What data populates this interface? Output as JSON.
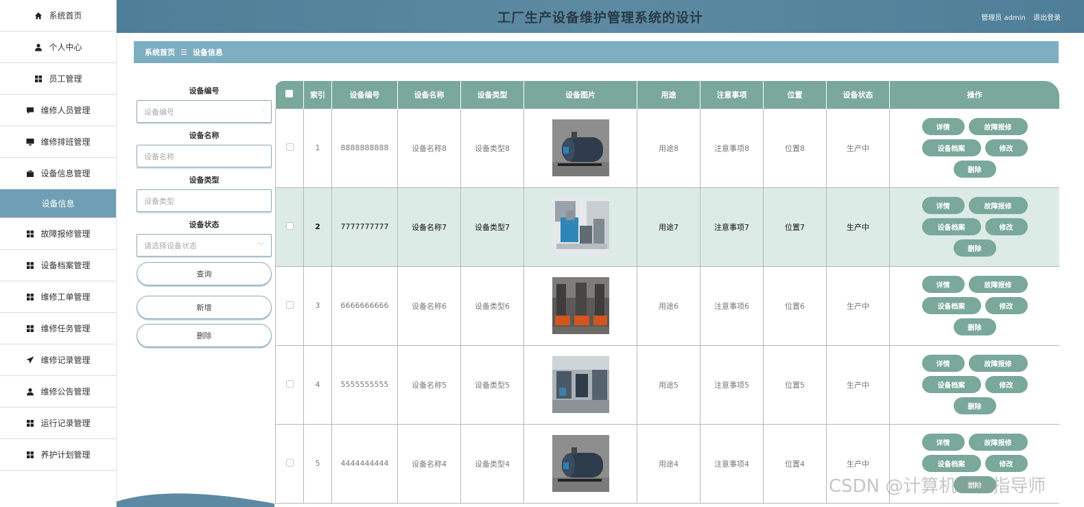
{
  "header": {
    "title": "工厂生产设备维护管理系统的设计",
    "user_label": "管理员 admin",
    "logout": "退出登录"
  },
  "sidebar": {
    "items": [
      {
        "label": "系统首页",
        "icon": "home-icon"
      },
      {
        "label": "个人中心",
        "icon": "user-icon"
      },
      {
        "label": "员工管理",
        "icon": "grid-icon"
      },
      {
        "label": "维修人员管理",
        "icon": "chat-icon"
      },
      {
        "label": "维修排班管理",
        "icon": "monitor-icon"
      },
      {
        "label": "设备信息管理",
        "icon": "wallet-icon"
      },
      {
        "label": "设备信息",
        "icon": ""
      },
      {
        "label": "故障报修管理",
        "icon": "grid-icon"
      },
      {
        "label": "设备档案管理",
        "icon": "grid-icon"
      },
      {
        "label": "维修工单管理",
        "icon": "grid-icon"
      },
      {
        "label": "维修任务管理",
        "icon": "grid-icon"
      },
      {
        "label": "维修记录管理",
        "icon": "send-icon"
      },
      {
        "label": "维修公告管理",
        "icon": "user-icon"
      },
      {
        "label": "运行记录管理",
        "icon": "grid-icon"
      },
      {
        "label": "养护计划管理",
        "icon": "grid-icon"
      }
    ]
  },
  "breadcrumb": {
    "home": "系统首页",
    "separator": "☰",
    "current": "设备信息"
  },
  "search": {
    "code_label": "设备编号",
    "code_placeholder": "设备编号",
    "name_label": "设备名称",
    "name_placeholder": "设备名称",
    "type_label": "设备类型",
    "type_placeholder": "设备类型",
    "status_label": "设备状态",
    "status_placeholder": "请选择设备状态",
    "query_btn": "查询",
    "add_btn": "新增",
    "delete_btn": "删除"
  },
  "table": {
    "headers": [
      "索引",
      "设备编号",
      "设备名称",
      "设备类型",
      "设备图片",
      "用途",
      "注意事项",
      "位置",
      "设备状态",
      "操作"
    ],
    "rows": [
      {
        "index": "1",
        "code": "8888888888",
        "name": "设备名称8",
        "type": "设备类型8",
        "image": "boiler",
        "use": "用途8",
        "note": "注意事项8",
        "location": "位置8",
        "status": "生产中"
      },
      {
        "index": "2",
        "code": "7777777777",
        "name": "设备名称7",
        "type": "设备类型7",
        "image": "blue-machine",
        "use": "用途7",
        "note": "注意事项7",
        "location": "位置7",
        "status": "生产中"
      },
      {
        "index": "3",
        "code": "6666666666",
        "name": "设备名称6",
        "type": "设备类型6",
        "image": "orange-line",
        "use": "用途6",
        "note": "注意事项6",
        "location": "位置6",
        "status": "生产中"
      },
      {
        "index": "4",
        "code": "5555555555",
        "name": "设备名称5",
        "type": "设备类型5",
        "image": "workshop",
        "use": "用途5",
        "note": "注意事项5",
        "location": "位置5",
        "status": "生产中"
      },
      {
        "index": "5",
        "code": "4444444444",
        "name": "设备名称4",
        "type": "设备类型4",
        "image": "boiler",
        "use": "用途4",
        "note": "注意事项4",
        "location": "位置4",
        "status": "生产中"
      }
    ],
    "actions": {
      "detail": "详情",
      "report": "故障报修",
      "archive": "设备档案",
      "edit": "修改",
      "delete": "删除"
    }
  },
  "watermark": "CSDN @计算机编程指导师",
  "colors": {
    "accent": "#7aa89a",
    "header": "#5d8aa2",
    "breadcrumb": "#7eaec2",
    "sidebar_active": "#6f9fb4"
  }
}
